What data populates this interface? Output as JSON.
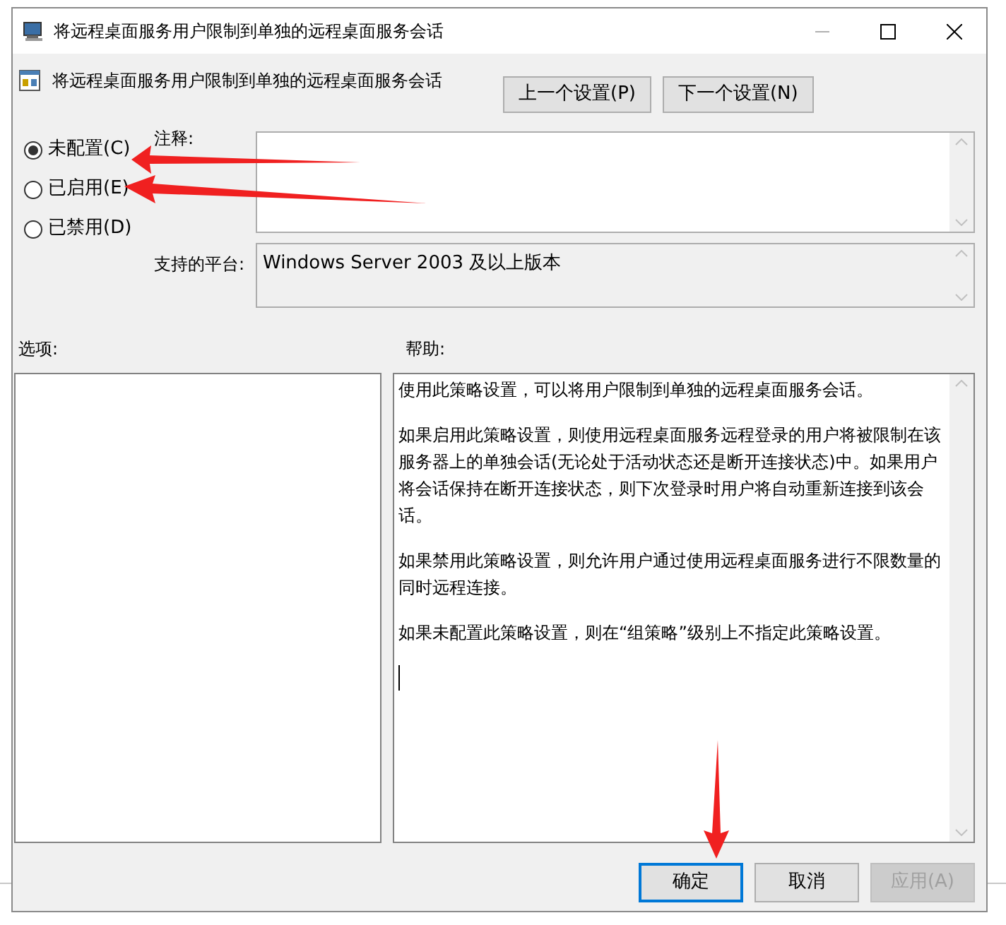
{
  "window": {
    "title": "将远程桌面服务用户限制到单独的远程桌面服务会话"
  },
  "header": {
    "title": "将远程桌面服务用户限制到单独的远程桌面服务会话",
    "buttons": [
      "上一个设置(P)",
      "下一个设置(N)"
    ]
  },
  "options": [
    {
      "label": "未配置(C)",
      "selected": true
    },
    {
      "label": "已启用(E)",
      "selected": false
    },
    {
      "label": "已禁用(D)",
      "selected": false
    }
  ],
  "comment": {
    "label": "注释:"
  },
  "platform": {
    "label": "支持的平台:",
    "value": "Windows Server 2003 及以上版本"
  },
  "options_section": {
    "label": "选项:"
  },
  "help": {
    "label": "帮助:",
    "paragraphs": [
      "使用此策略设置，可以将用户限制到单独的远程桌面服务会话。",
      "如果启用此策略设置，则使用远程桌面服务远程登录的用户将被限制在该服务器上的单独会话(无论处于活动状态还是断开连接状态)中。如果用户将会话保持在断开连接状态，则下次登录时用户将自动重新连接到该会话。",
      "如果禁用此策略设置，则允许用户通过使用远程桌面服务进行不限数量的同时远程连接。",
      "如果未配置此策略设置，则在“组策略”级别上不指定此策略设置。"
    ]
  },
  "footer_buttons": [
    {
      "label": "确定",
      "kind": "default",
      "disabled": false
    },
    {
      "label": "取消",
      "kind": "normal",
      "disabled": false
    },
    {
      "label": "应用(A)",
      "kind": "normal",
      "disabled": true
    }
  ]
}
